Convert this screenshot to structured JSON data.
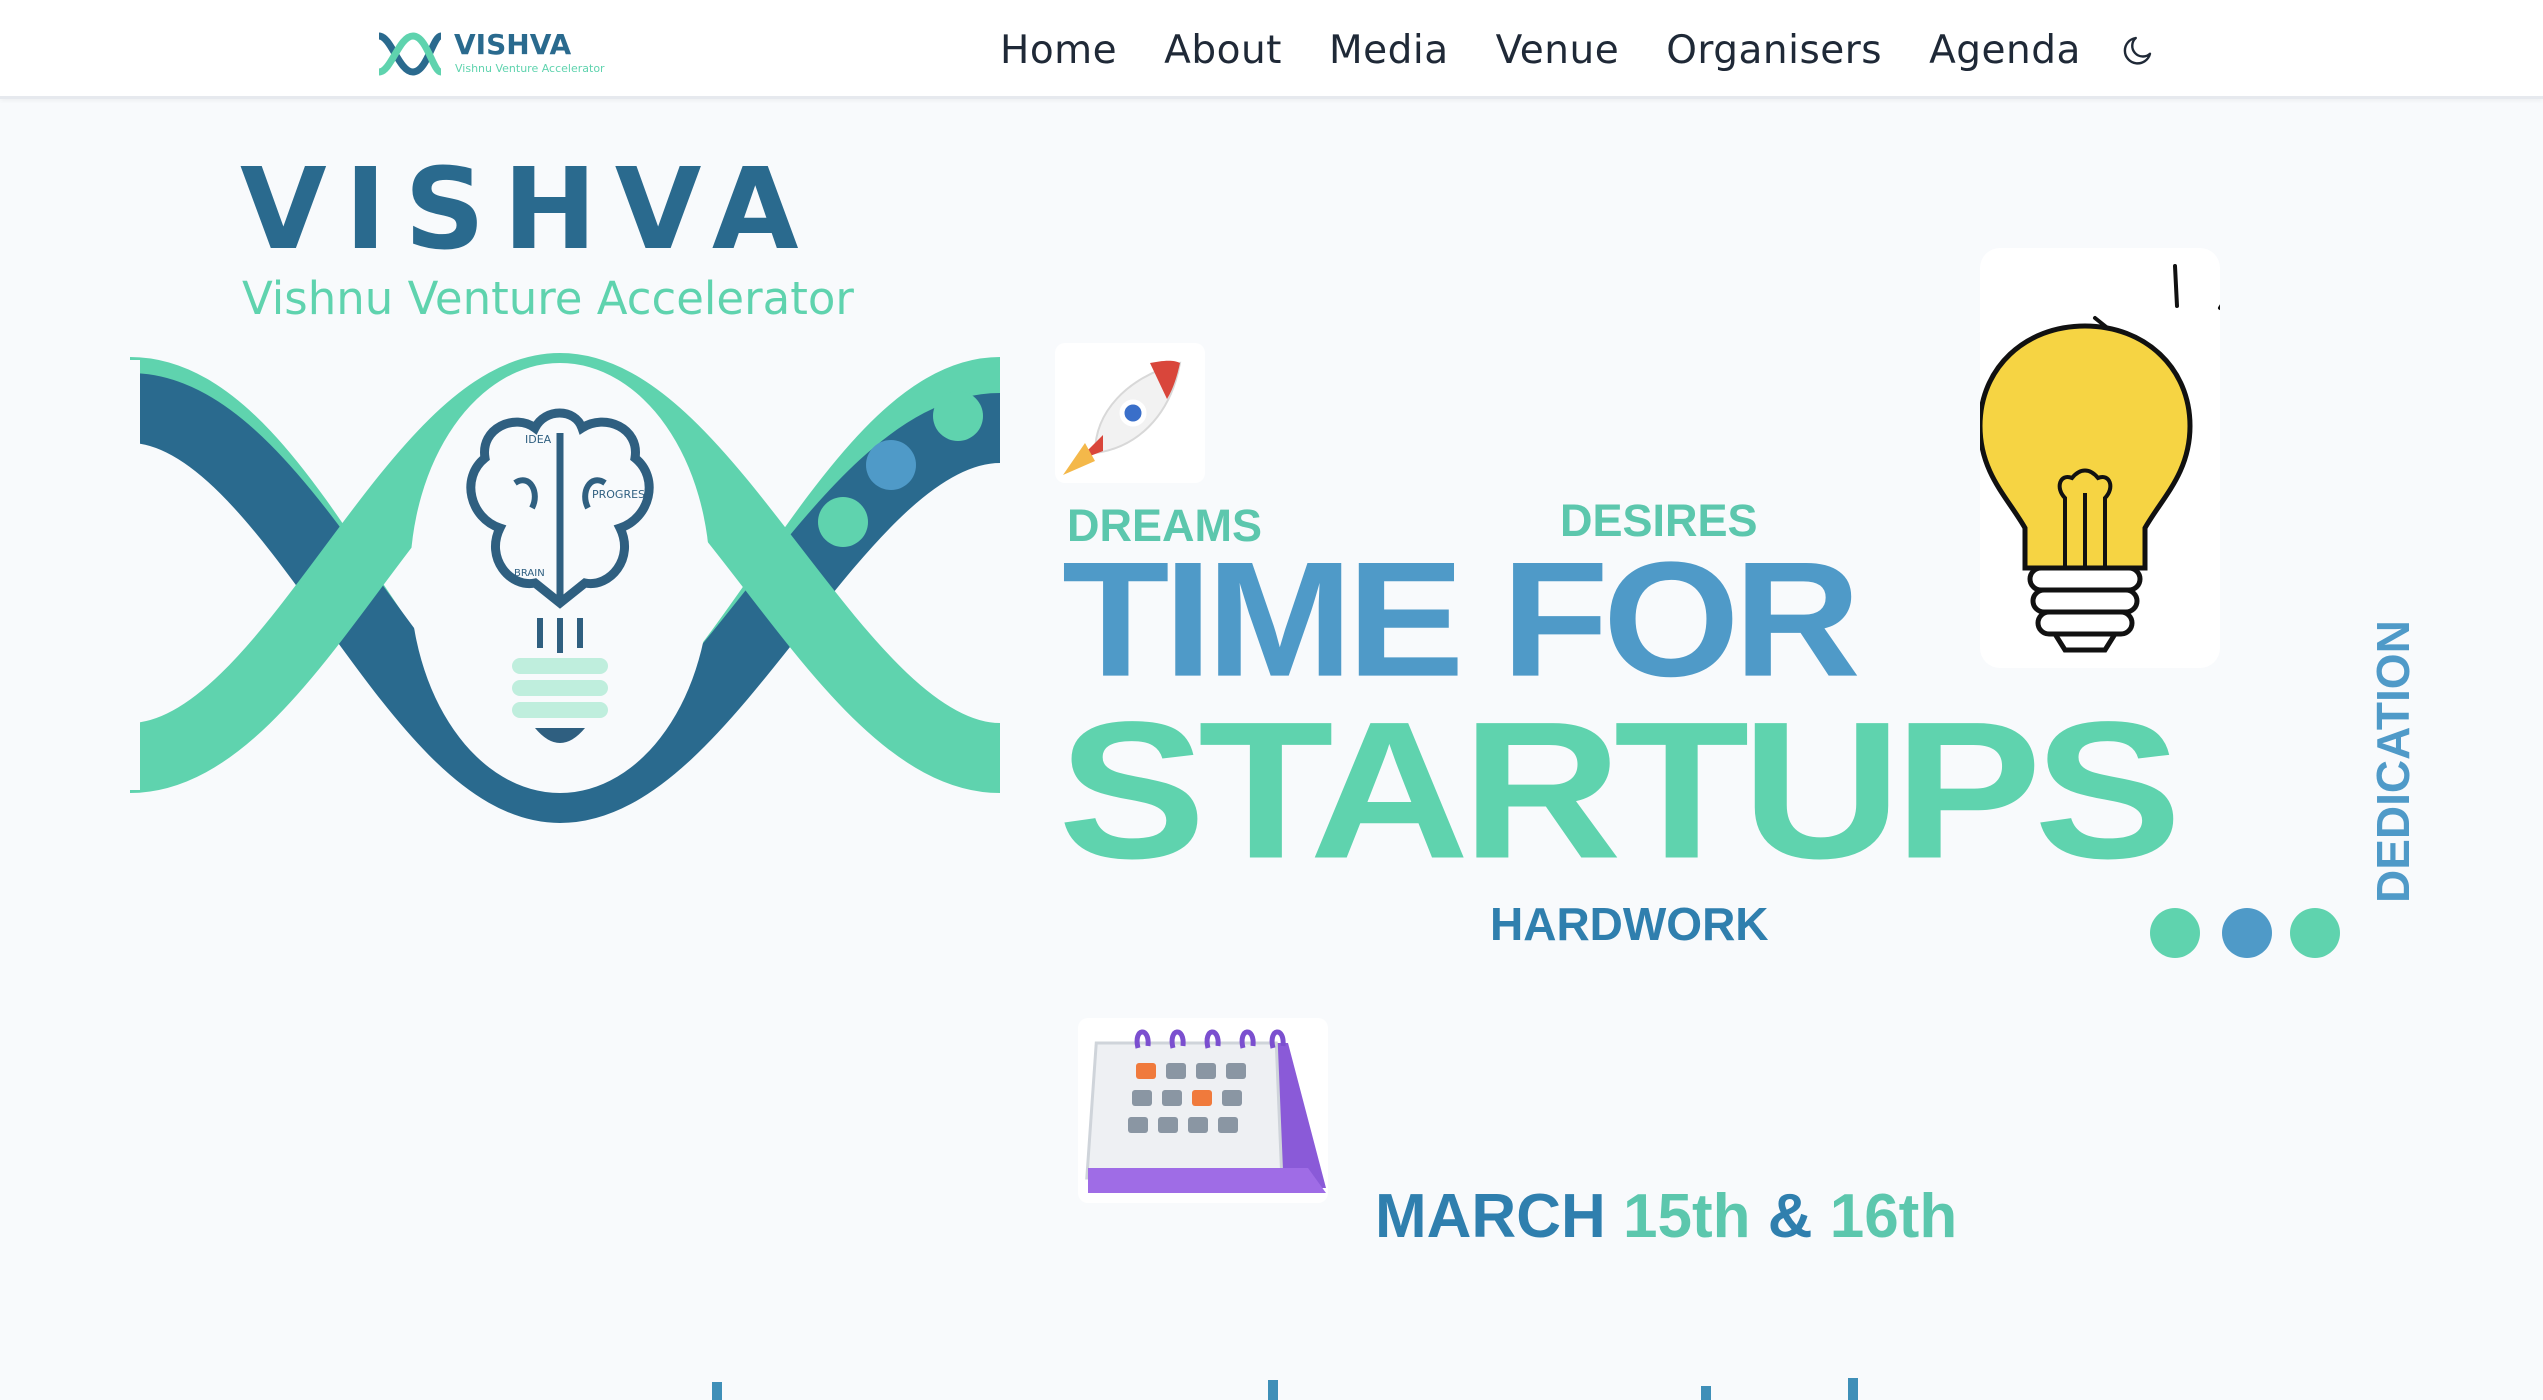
{
  "nav": {
    "brand_name": "VISHVA",
    "brand_tagline": "Vishnu Venture Accelerator",
    "links": [
      "Home",
      "About",
      "Media",
      "Venue",
      "Organisers",
      "Agenda"
    ],
    "theme_icon": "moon-icon"
  },
  "hero": {
    "brand_name": "VISHVA",
    "brand_tagline": "Vishnu Venture Accelerator",
    "brain_labels": [
      "IDEA",
      "PROGRESS",
      "BRAIN"
    ],
    "words": {
      "dreams": "DREAMS",
      "desires": "DESIRES",
      "time_for": "TIME FOR",
      "startups": "STARTUPS",
      "hardwork": "HARDWORK",
      "dedication": "DEDICATION"
    },
    "date": {
      "month": "MARCH",
      "day1": "15th",
      "amp": "&",
      "day2": "16th"
    },
    "icons": [
      "rocket-icon",
      "lightbulb-icon",
      "calendar-icon",
      "brain-icon"
    ]
  },
  "colors": {
    "teal": "#5fd3ae",
    "navy": "#2a6a8e",
    "blue": "#4f9ac8",
    "background": "#f8fafc"
  }
}
